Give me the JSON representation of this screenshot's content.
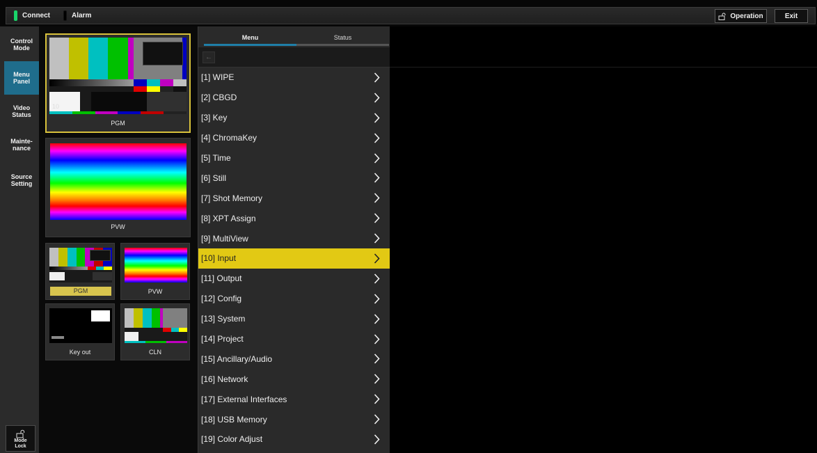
{
  "topbar": {
    "connect_label": "Connect",
    "alarm_label": "Alarm",
    "operation_label": "Operation",
    "exit_label": "Exit"
  },
  "nav": {
    "items": [
      {
        "line1": "Control",
        "line2": "Mode"
      },
      {
        "line1": "Menu",
        "line2": "Panel"
      },
      {
        "line1": "Video",
        "line2": "Status"
      },
      {
        "line1": "Mainte-",
        "line2": "nance"
      },
      {
        "line1": "Source",
        "line2": "Setting"
      }
    ],
    "mode_lock": {
      "line1": "Mode",
      "line2": "Lock"
    }
  },
  "monitors": {
    "pgm_big": "PGM",
    "overlay_text": "10",
    "pvw_big": "PVW",
    "pgm_small": "PGM",
    "pvw_small": "PVW",
    "keyout": "Key out",
    "cln": "CLN"
  },
  "tabs": {
    "menu": "Menu",
    "status": "Status"
  },
  "toolbar": {
    "back_icon": "back-arrow-icon"
  },
  "menu": {
    "items": [
      "[1] WIPE",
      "[2] CBGD",
      "[3] Key",
      "[4] ChromaKey",
      "[5] Time",
      "[6] Still",
      "[7] Shot Memory",
      "[8] XPT Assign",
      "[9] MultiView",
      "[10] Input",
      "[11] Output",
      "[12] Config",
      "[13] System",
      "[14] Project",
      "[15] Ancillary/Audio",
      "[16] Network",
      "[17] External Interfaces",
      "[18] USB Memory",
      "[19] Color Adjust"
    ],
    "selected_index": 9
  },
  "colors": {
    "accent_blue": "#1f6d8c",
    "selected_yellow": "#e2c914",
    "connect_green": "#19d46a"
  }
}
